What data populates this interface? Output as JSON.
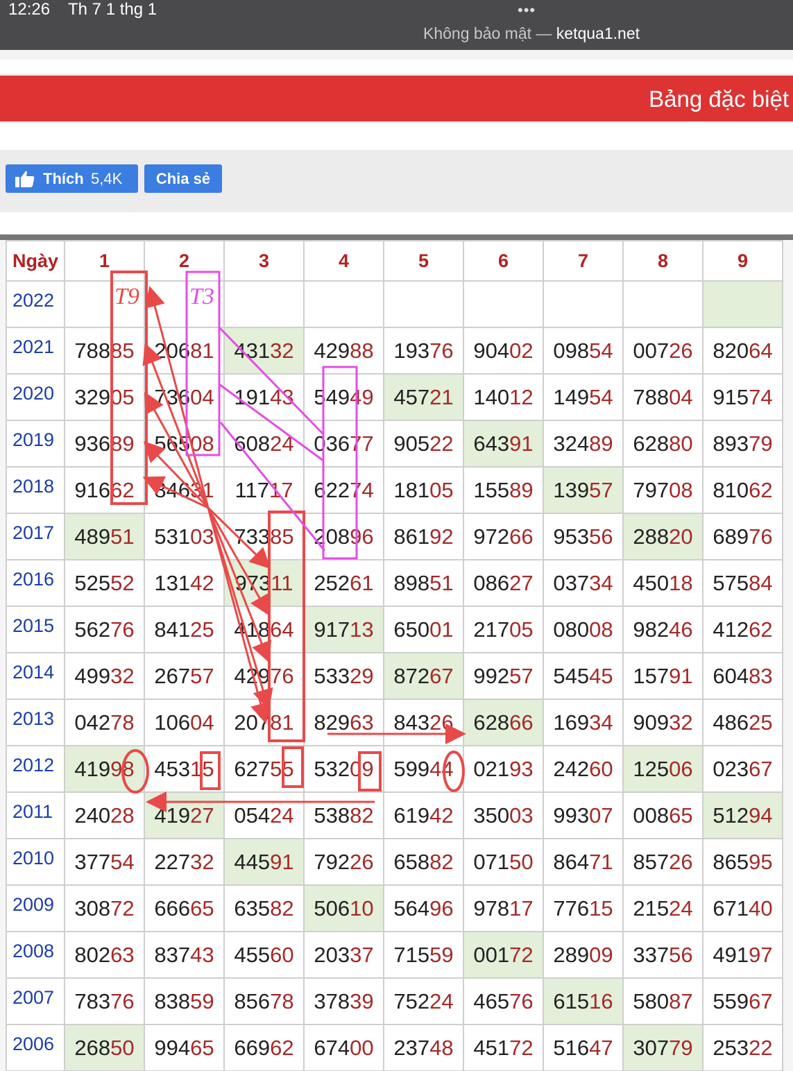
{
  "status": {
    "time": "12:26",
    "date": "Th 7 1 thg 1",
    "dots": "•••",
    "security": "Không bảo mật — ",
    "domain": "ketqua1.net"
  },
  "banner": {
    "title": "Bảng đặc biệt"
  },
  "social": {
    "like_label": "Thích",
    "like_count": "5,4K",
    "share_label": "Chia sẻ"
  },
  "table": {
    "headers": [
      "Ngày",
      "1",
      "2",
      "3",
      "4",
      "5",
      "6",
      "7",
      "8",
      "9"
    ],
    "rows": [
      {
        "year": "2022",
        "values": [
          "",
          "",
          "",
          "",
          "",
          "",
          "",
          "",
          ""
        ],
        "highlight": [
          8
        ]
      },
      {
        "year": "2021",
        "values": [
          "78885",
          "20681",
          "43132",
          "42988",
          "19376",
          "90402",
          "09854",
          "00726",
          "82064"
        ],
        "highlight": [
          2
        ]
      },
      {
        "year": "2020",
        "values": [
          "32905",
          "73604",
          "19143",
          "54949",
          "45721",
          "14012",
          "14954",
          "78804",
          "91574"
        ],
        "highlight": [
          4
        ]
      },
      {
        "year": "2019",
        "values": [
          "93689",
          "56508",
          "60824",
          "03677",
          "90522",
          "64391",
          "32489",
          "62880",
          "89379"
        ],
        "highlight": [
          5
        ]
      },
      {
        "year": "2018",
        "values": [
          "91662",
          "84631",
          "11717",
          "62274",
          "18105",
          "15589",
          "13957",
          "79708",
          "81062"
        ],
        "highlight": [
          6
        ]
      },
      {
        "year": "2017",
        "values": [
          "48951",
          "53103",
          "73385",
          "20896",
          "86192",
          "97266",
          "95356",
          "28820",
          "68976"
        ],
        "highlight": [
          0,
          7
        ]
      },
      {
        "year": "2016",
        "values": [
          "52552",
          "13142",
          "97311",
          "25261",
          "89851",
          "08627",
          "03734",
          "45018",
          "57584"
        ],
        "highlight": [
          2
        ]
      },
      {
        "year": "2015",
        "values": [
          "56276",
          "84125",
          "41864",
          "91713",
          "65001",
          "21705",
          "08008",
          "98246",
          "41262"
        ],
        "highlight": [
          3
        ]
      },
      {
        "year": "2014",
        "values": [
          "49932",
          "26757",
          "42976",
          "53329",
          "87267",
          "99257",
          "54545",
          "15791",
          "60483"
        ],
        "highlight": [
          4
        ]
      },
      {
        "year": "2013",
        "values": [
          "04278",
          "10604",
          "20781",
          "82963",
          "84326",
          "62866",
          "16934",
          "90932",
          "48625"
        ],
        "highlight": [
          5
        ]
      },
      {
        "year": "2012",
        "values": [
          "41998",
          "45315",
          "62755",
          "53209",
          "59944",
          "02193",
          "24260",
          "12506",
          "02367"
        ],
        "highlight": [
          0,
          7
        ]
      },
      {
        "year": "2011",
        "values": [
          "24028",
          "41927",
          "05424",
          "53882",
          "61942",
          "35003",
          "99307",
          "00865",
          "51294"
        ],
        "highlight": [
          1,
          8
        ]
      },
      {
        "year": "2010",
        "values": [
          "37754",
          "22732",
          "44591",
          "79226",
          "65882",
          "07150",
          "86471",
          "85726",
          "86595"
        ],
        "highlight": [
          2
        ]
      },
      {
        "year": "2009",
        "values": [
          "30872",
          "66665",
          "63582",
          "50610",
          "56496",
          "97817",
          "77615",
          "21524",
          "67140"
        ],
        "highlight": [
          3
        ]
      },
      {
        "year": "2008",
        "values": [
          "80263",
          "83743",
          "45560",
          "20337",
          "71559",
          "00172",
          "28909",
          "33756",
          "49197"
        ],
        "highlight": [
          5
        ]
      },
      {
        "year": "2007",
        "values": [
          "78376",
          "83859",
          "85678",
          "37839",
          "75224",
          "46576",
          "61516",
          "58087",
          "55967"
        ],
        "highlight": [
          6
        ]
      },
      {
        "year": "2006",
        "values": [
          "26850",
          "99465",
          "66962",
          "67400",
          "23748",
          "45172",
          "51647",
          "30779",
          "25322"
        ],
        "highlight": [
          0,
          7
        ]
      }
    ]
  },
  "annotations": {
    "label_t9": "T9",
    "label_t3": "T3"
  },
  "colors": {
    "banner": "#dd3333",
    "header_text": "#b22222",
    "year_text": "#1a3ea8",
    "tail_digits": "#a52a2a",
    "highlight_cell": "#e3efd9",
    "annot_red": "#e84a4a",
    "annot_magenta": "#e44ee4",
    "fb_button": "#3b7de0"
  }
}
